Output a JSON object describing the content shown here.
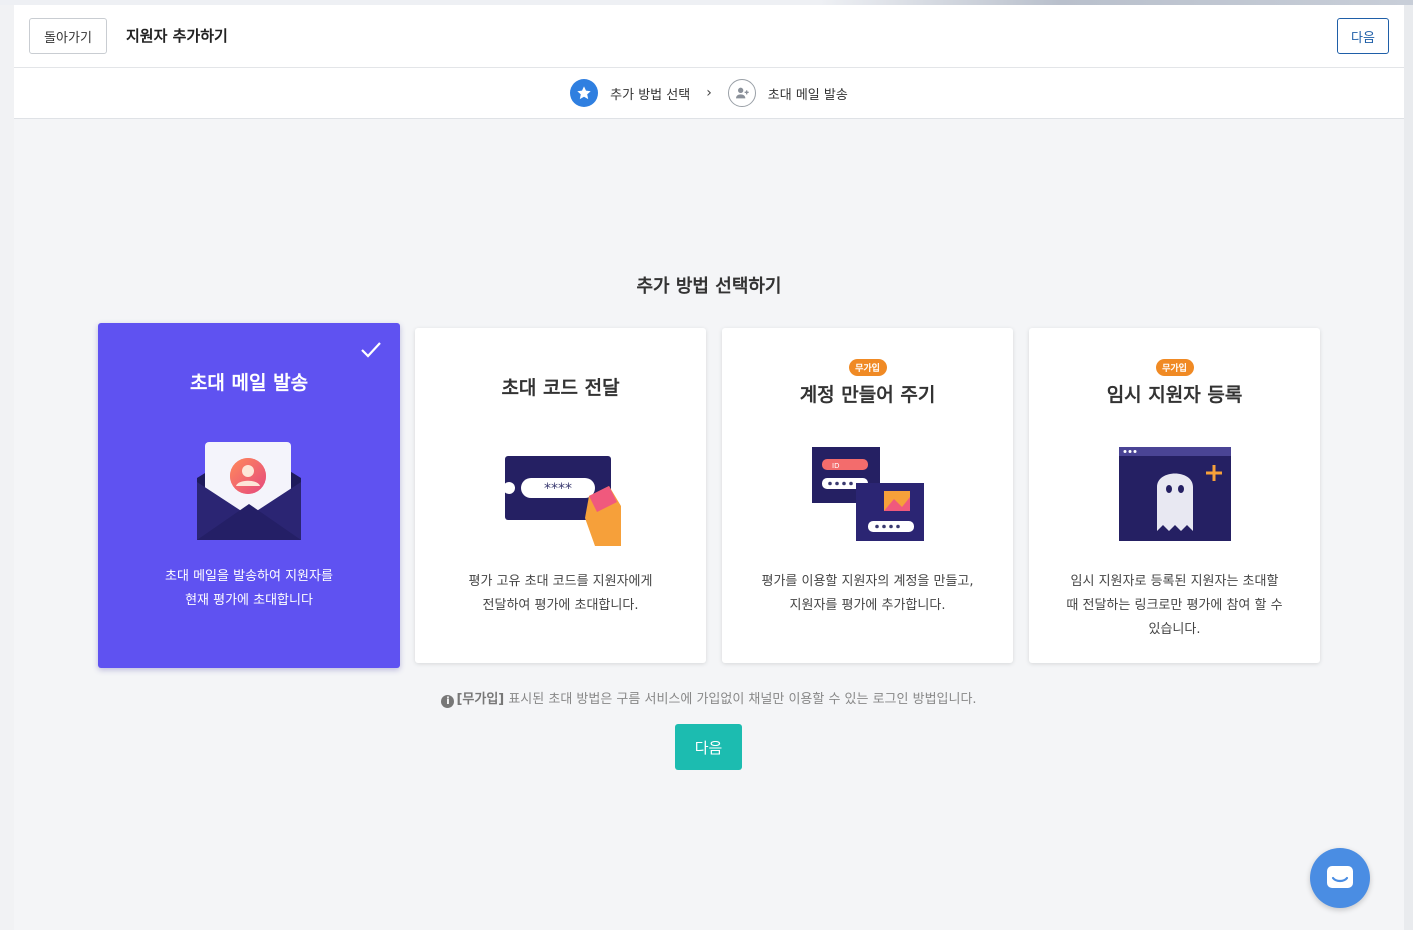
{
  "header": {
    "back_label": "돌아가기",
    "title": "지원자 추가하기",
    "next_label": "다음"
  },
  "stepper": {
    "steps": [
      {
        "label": "추가 방법 선택",
        "icon": "star-icon",
        "active": true
      },
      {
        "label": "초대 메일 발송",
        "icon": "add-user-icon",
        "active": false
      }
    ],
    "separator": "›"
  },
  "main": {
    "section_title": "추가 방법 선택하기",
    "cards": [
      {
        "title": "초대 메일 발송",
        "desc_line1": "초대 메일을 발송하여 지원자를",
        "desc_line2": "현재 평가에 초대합니다",
        "selected": true
      },
      {
        "title": "초대 코드 전달",
        "desc_line1": "평가 고유 초대 코드를 지원자에게",
        "desc_line2": "전달하여 평가에 초대합니다.",
        "code_mask": "****"
      },
      {
        "title": "계정 만들어 주기",
        "badge": "무가입",
        "desc_line1": "평가를 이용할 지원자의 계정을 만들고,",
        "desc_line2": "지원자를 평가에 추가합니다.",
        "id_tag": "ID"
      },
      {
        "title": "임시 지원자 등록",
        "badge": "무가입",
        "desc_line1": "임시 지원자로 등록된 지원자는 초대할",
        "desc_line2": "때 전달하는 링크로만 평가에 참여 할 수",
        "desc_line3": "있습니다."
      }
    ],
    "note_icon": "i",
    "note_badge": "[무가입]",
    "note_text": " 표시된 초대 방법은 구름 서비스에 가입없이 채널만 이용할 수 있는 로그인 방법입니다.",
    "next_label": "다음"
  },
  "colors": {
    "selected_card": "#5f52f1",
    "accent_teal": "#1cbcb0",
    "badge_orange": "#f08a24",
    "step_active": "#2f7fe0",
    "chat_button": "#4a8de3"
  }
}
